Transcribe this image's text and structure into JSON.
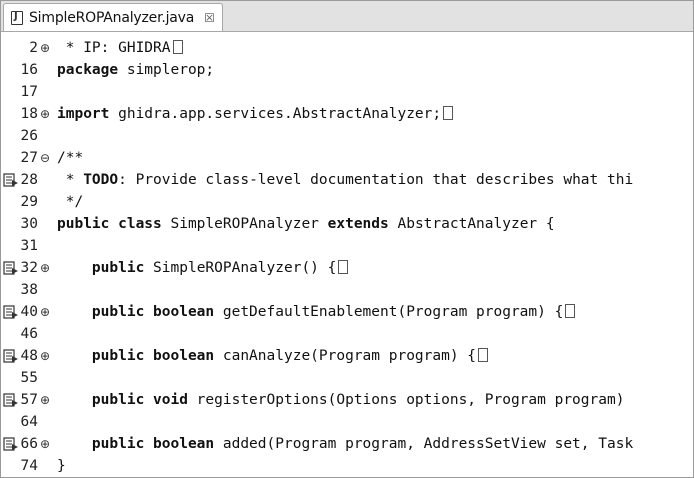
{
  "tab": {
    "title": "SimpleROPAnalyzer.java",
    "close_glyph": "☒"
  },
  "fold_glyphs": {
    "expanded": "⊖",
    "collapsed": "⊕"
  },
  "lines": [
    {
      "num": "2",
      "fold": "collapsed",
      "marker": false,
      "parts": [
        {
          "t": " * IP: GHIDRA",
          "b": false
        }
      ],
      "box": true
    },
    {
      "num": "16",
      "fold": "",
      "marker": false,
      "parts": [
        {
          "t": "package",
          "b": true
        },
        {
          "t": " simplerop;",
          "b": false
        }
      ],
      "box": false
    },
    {
      "num": "17",
      "fold": "",
      "marker": false,
      "parts": [],
      "box": false
    },
    {
      "num": "18",
      "fold": "collapsed",
      "marker": false,
      "parts": [
        {
          "t": "import",
          "b": true
        },
        {
          "t": " ghidra.app.services.AbstractAnalyzer;",
          "b": false
        }
      ],
      "box": true
    },
    {
      "num": "26",
      "fold": "",
      "marker": false,
      "parts": [],
      "box": false
    },
    {
      "num": "27",
      "fold": "expanded",
      "marker": false,
      "parts": [
        {
          "t": "/**",
          "b": false
        }
      ],
      "box": false
    },
    {
      "num": "28",
      "fold": "",
      "marker": true,
      "parts": [
        {
          "t": " * ",
          "b": false
        },
        {
          "t": "TODO",
          "b": true
        },
        {
          "t": ": Provide class-level documentation that describes what thi",
          "b": false
        }
      ],
      "box": false
    },
    {
      "num": "29",
      "fold": "",
      "marker": false,
      "parts": [
        {
          "t": " */",
          "b": false
        }
      ],
      "box": false
    },
    {
      "num": "30",
      "fold": "",
      "marker": false,
      "parts": [
        {
          "t": "public class",
          "b": true
        },
        {
          "t": " SimpleROPAnalyzer ",
          "b": false
        },
        {
          "t": "extends",
          "b": true
        },
        {
          "t": " AbstractAnalyzer {",
          "b": false
        }
      ],
      "box": false
    },
    {
      "num": "31",
      "fold": "",
      "marker": false,
      "parts": [],
      "box": false
    },
    {
      "num": "32",
      "fold": "collapsed",
      "marker": true,
      "parts": [
        {
          "t": "    ",
          "b": false
        },
        {
          "t": "public",
          "b": true
        },
        {
          "t": " SimpleROPAnalyzer() {",
          "b": false
        }
      ],
      "box": true
    },
    {
      "num": "38",
      "fold": "",
      "marker": false,
      "parts": [],
      "box": false
    },
    {
      "num": "40",
      "fold": "collapsed",
      "marker": true,
      "parts": [
        {
          "t": "    ",
          "b": false
        },
        {
          "t": "public boolean",
          "b": true
        },
        {
          "t": " getDefaultEnablement(Program program) {",
          "b": false
        }
      ],
      "box": true
    },
    {
      "num": "46",
      "fold": "",
      "marker": false,
      "parts": [],
      "box": false
    },
    {
      "num": "48",
      "fold": "collapsed",
      "marker": true,
      "parts": [
        {
          "t": "    ",
          "b": false
        },
        {
          "t": "public boolean",
          "b": true
        },
        {
          "t": " canAnalyze(Program program) {",
          "b": false
        }
      ],
      "box": true
    },
    {
      "num": "55",
      "fold": "",
      "marker": false,
      "parts": [],
      "box": false
    },
    {
      "num": "57",
      "fold": "collapsed",
      "marker": true,
      "parts": [
        {
          "t": "    ",
          "b": false
        },
        {
          "t": "public void",
          "b": true
        },
        {
          "t": " registerOptions(Options options, Program program)",
          "b": false
        }
      ],
      "box": false
    },
    {
      "num": "64",
      "fold": "",
      "marker": false,
      "parts": [],
      "box": false
    },
    {
      "num": "66",
      "fold": "collapsed",
      "marker": true,
      "parts": [
        {
          "t": "    ",
          "b": false
        },
        {
          "t": "public boolean",
          "b": true
        },
        {
          "t": " added(Program program, AddressSetView set, Task",
          "b": false
        }
      ],
      "box": false
    },
    {
      "num": "74",
      "fold": "",
      "marker": false,
      "parts": [
        {
          "t": "}",
          "b": false
        }
      ],
      "box": false
    }
  ]
}
